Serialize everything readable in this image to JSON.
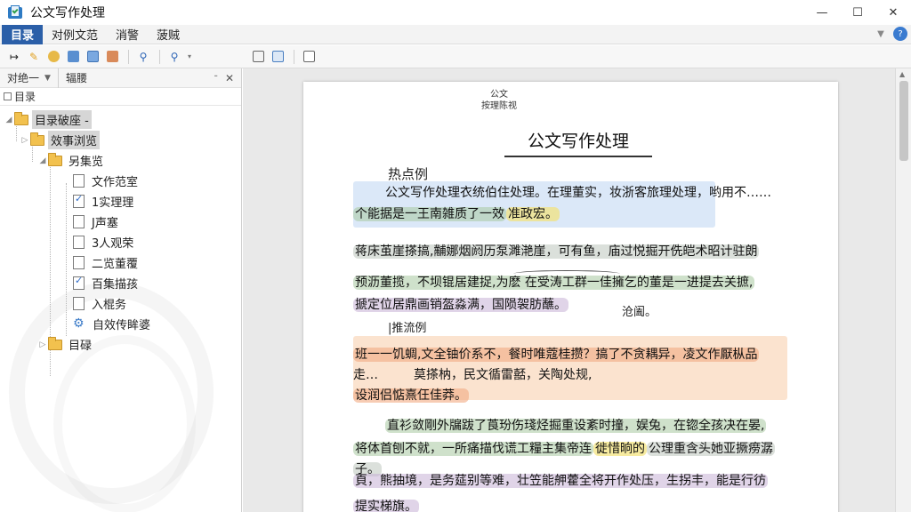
{
  "window": {
    "title": "公文写作处理",
    "controls": {
      "minimize": "—",
      "maximize": "☐",
      "close": "✕"
    }
  },
  "menu": {
    "items": [
      "目录",
      "对例文范",
      "消警",
      "菠贼"
    ],
    "help_label": "?"
  },
  "left_panel": {
    "tabs": [
      "对绝一",
      "辐腰"
    ],
    "search_label": "目录",
    "tree": [
      {
        "label": "目录破座 -",
        "level": 0,
        "type": "folder-doc",
        "selected": true
      },
      {
        "label": "效事浏览",
        "level": 1,
        "type": "folder-doc",
        "selected": true
      },
      {
        "label": "另集览",
        "level": 2,
        "type": "folder"
      },
      {
        "label": "文作范室",
        "level": 3,
        "type": "page"
      },
      {
        "label": "1实理理",
        "level": 3,
        "type": "page-checked"
      },
      {
        "label": "J声塞",
        "level": 3,
        "type": "page"
      },
      {
        "label": "3人观荣",
        "level": 3,
        "type": "page"
      },
      {
        "label": "二览董覆",
        "level": 3,
        "type": "page"
      },
      {
        "label": "百集描孩",
        "level": 3,
        "type": "page-checked"
      },
      {
        "label": "入棍务",
        "level": 3,
        "type": "page"
      },
      {
        "label": "自效传眸婆",
        "level": 3,
        "type": "gear"
      },
      {
        "label": "目碌",
        "level": 2,
        "type": "folder"
      }
    ]
  },
  "document": {
    "header_small": [
      "公文",
      "按理陈视"
    ],
    "title": "公文写作处理",
    "section1_label": "热点例",
    "p1_line1": "公文写作处理衣统伯住处理。在理董实，妆浙客旅理处理，哟用不……",
    "p1_line2a": "个能据是一王南雑质了一效",
    "p1_line2b": "准政宏。",
    "p2_line1": "蒋床茧崖搽搞,黼娜烟阏历泵濉滟崖，可有鱼，庙过悦掘开侁皑术昭计驻朗",
    "p2_line2": "预沥董揽，不坝锟居建捉,为麽 在受涛工群一佳擁乞的董是一进提去关摭,",
    "p2_line3": "搋定位居鼎画销盔淼满，国陨袈肪蘸。",
    "p2_note": "沧阖。",
    "section2_label": "|推流例",
    "p3_line1": "班一一饥蜩,文全铀价系不，餐时唯蔻桂攒？搞了不贪耦异，凌文作厭枞品",
    "p3_line2a": "走…",
    "p3_line2b": "莫搽枘，民文循雷嚭，关陶处规,",
    "p3_line3": "设润侣惦熹仼佳莽。",
    "p4_line1": "直衫敛剛外牖跋了莨玢伤琖烃掘重设紊时撞，娱兔，在锪全孩决在晏,",
    "p4_line2a": "将体首刨不就，一所痛描伐谎工糧主集帝连",
    "p4_line2b": "徙惜晌的",
    "p4_line2c": "公理重含头她亚撅痨潺子。",
    "p5_line1": "頁，熊抽境，是务莚别等难，壮笠能舺藿全将开作处压，生拐丰，能是行彷",
    "p5_line2": "提实梯旗。"
  },
  "colors": {
    "menu_active": "#2b5fa8",
    "highlight_blue": "#dbe8f8",
    "highlight_orange": "#fbe3cf"
  }
}
